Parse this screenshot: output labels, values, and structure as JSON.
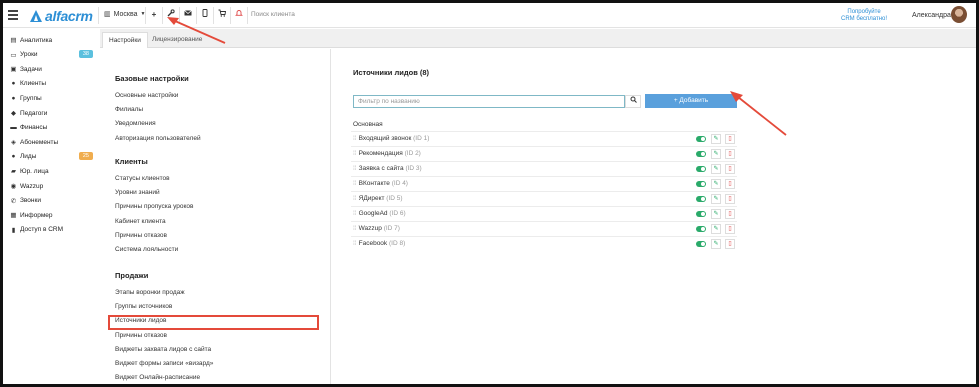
{
  "topbar": {
    "logo_text": "alfacrm",
    "city": "Москва",
    "search_placeholder": "Поиск клиента",
    "try_line1": "Попробуйте",
    "try_line2": "CRM бесплатно!",
    "user_name": "Александра",
    "icons": [
      "plus-icon",
      "wrench-icon",
      "mail-icon",
      "phone-icon",
      "cart-icon",
      "bell-icon"
    ]
  },
  "sidebar": {
    "items": [
      {
        "label": "Аналитика",
        "icon": "chart-icon"
      },
      {
        "label": "Уроки",
        "icon": "calendar-icon",
        "badge": "38",
        "badge_color": "#5bc0de"
      },
      {
        "label": "Задачи",
        "icon": "tasks-icon"
      },
      {
        "label": "Клиенты",
        "icon": "user-icon"
      },
      {
        "label": "Группы",
        "icon": "users-icon"
      },
      {
        "label": "Педагоги",
        "icon": "graduation-icon"
      },
      {
        "label": "Финансы",
        "icon": "money-icon"
      },
      {
        "label": "Абонементы",
        "icon": "tag-icon"
      },
      {
        "label": "Лиды",
        "icon": "lead-icon",
        "badge": "25",
        "badge_color": "#f0ad4e"
      },
      {
        "label": "Юр. лица",
        "icon": "briefcase-icon"
      },
      {
        "label": "Wazzup",
        "icon": "chat-icon"
      },
      {
        "label": "Звонки",
        "icon": "phone-icon"
      },
      {
        "label": "Информер",
        "icon": "info-icon"
      },
      {
        "label": "Доступ в CRM",
        "icon": "lock-icon"
      }
    ]
  },
  "tabs": [
    {
      "label": "Настройки",
      "active": true
    },
    {
      "label": "Лицензирование",
      "active": false
    }
  ],
  "settings": {
    "sections": [
      {
        "title": "Базовые настройки",
        "links": [
          "Основные настройки",
          "Филиалы",
          "Уведомления",
          "Авторизация пользователей"
        ]
      },
      {
        "title": "Клиенты",
        "links": [
          "Статусы клиентов",
          "Уровни знаний",
          "Причины пропуска уроков",
          "Кабинет клиента",
          "Причины отказов",
          "Система лояльности"
        ]
      },
      {
        "title": "Продажи",
        "links": [
          "Этапы воронки продаж",
          "Группы источников",
          "Источники лидов",
          "Причины отказов",
          "Виджеты захвата лидов с сайта",
          "Виджет формы записи «визард»",
          "Виджет Онлайн-расписание"
        ]
      }
    ]
  },
  "content": {
    "title": "Источники лидов (8)",
    "filter_placeholder": "Фильтр по названию",
    "add_label": "+ Добавить",
    "group_label": "Основная",
    "rows": [
      {
        "name": "Входящий звонок",
        "id": "(ID 1)"
      },
      {
        "name": "Рекомендация",
        "id": "(ID 2)"
      },
      {
        "name": "Заявка с сайта",
        "id": "(ID 3)"
      },
      {
        "name": "ВКонтакте",
        "id": "(ID 4)"
      },
      {
        "name": "ЯДирект",
        "id": "(ID 5)"
      },
      {
        "name": "GoogleAd",
        "id": "(ID 6)"
      },
      {
        "name": "Wazzup",
        "id": "(ID 7)"
      },
      {
        "name": "Facebook",
        "id": "(ID 8)"
      }
    ]
  },
  "colors": {
    "accent": "#2d8fd5",
    "add_button": "#5aa0dc",
    "toggle_on": "#2aaa6a",
    "highlight": "#e44a3a"
  }
}
